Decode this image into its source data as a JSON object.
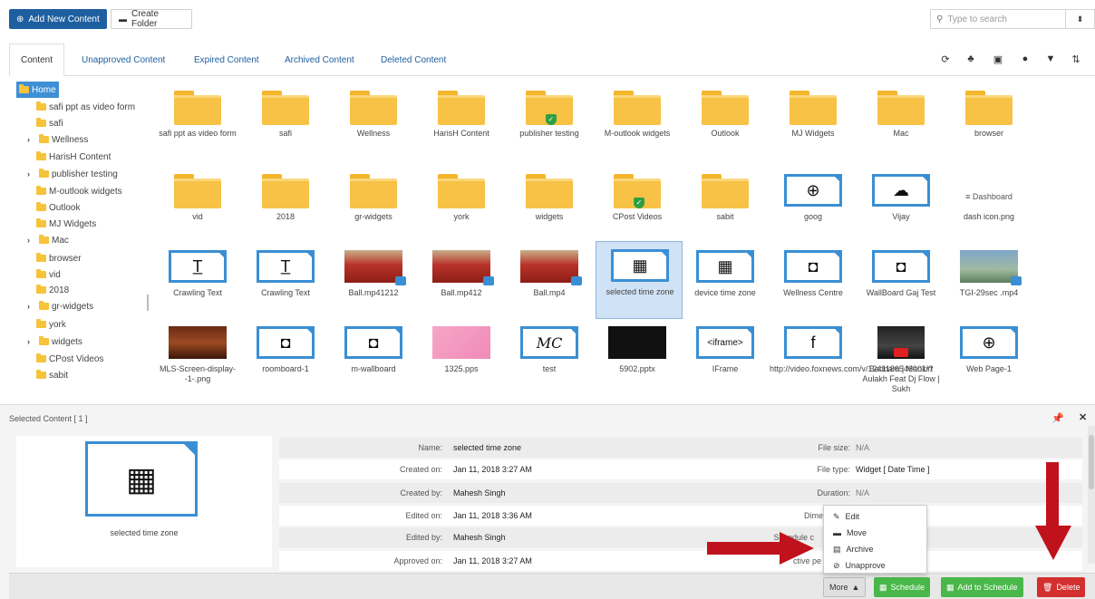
{
  "toolbar": {
    "add_label": "Add New Content",
    "folder_label": "Create Folder",
    "search_placeholder": "Type to search"
  },
  "tabs": [
    {
      "label": "Content"
    },
    {
      "label": "Unapproved Content"
    },
    {
      "label": "Expired Content"
    },
    {
      "label": "Archived Content"
    },
    {
      "label": "Deleted Content"
    }
  ],
  "tree": {
    "home": "Home",
    "items": [
      {
        "label": "safi ppt as video form"
      },
      {
        "label": "safi"
      },
      {
        "label": "Wellness"
      },
      {
        "label": "HarisH Content"
      },
      {
        "label": "publisher testing"
      },
      {
        "label": "M-outlook widgets"
      },
      {
        "label": "Outlook"
      },
      {
        "label": "MJ Widgets"
      },
      {
        "label": "Mac"
      },
      {
        "label": "browser"
      },
      {
        "label": "vid"
      },
      {
        "label": "2018"
      },
      {
        "label": "gr-widgets"
      },
      {
        "label": "york"
      },
      {
        "label": "widgets"
      },
      {
        "label": "CPost Videos"
      },
      {
        "label": "sabit"
      }
    ]
  },
  "grid": {
    "row1": [
      "safi ppt as video form",
      "safi",
      "Wellness",
      "HarisH Content",
      "publisher testing",
      "M-outlook widgets",
      "Outlook",
      "MJ Widgets",
      "Mac",
      "browser"
    ],
    "row2": [
      "vid",
      "2018",
      "gr-widgets",
      "york",
      "widgets",
      "CPost Videos",
      "sabit",
      "goog",
      "Vijay",
      "dash icon.png"
    ],
    "row3": [
      "Crawling Text",
      "Crawling Text",
      "Ball.mp41212",
      "Ball.mp412",
      "Ball.mp4",
      "selected time zone",
      "device time zone",
      "Wellness Centre",
      "WallBoard Gaj Test",
      "TGI-29sec .mp4"
    ],
    "row4": [
      "MLS-Screen-display--1-.png",
      "roomboard-1",
      "m-wallboard",
      "1325.pps",
      "test",
      "5902.pptx",
      "IFrame",
      "http://video.foxnews.com/v/1241186546001/?",
      "Badnam | Mankirt Aulakh Feat Dj Flow | Sukh",
      "Web Page-1"
    ],
    "dashboard_text": "≡ Dashboard",
    "iframe_text": "<iframe>",
    "mc_text": "MC"
  },
  "selected": {
    "header": "Selected Content [ 1 ]",
    "preview_label": "selected time zone",
    "fields": {
      "name_label": "Name:",
      "name": "selected time zone",
      "created_on_label": "Created on:",
      "created_on": "Jan 11, 2018 3:27 AM",
      "created_by_label": "Created by:",
      "created_by": "Mahesh Singh",
      "edited_on_label": "Edited on:",
      "edited_on": "Jan 11, 2018 3:36 AM",
      "edited_by_label": "Edited by:",
      "edited_by": "Mahesh Singh",
      "approved_on_label": "Approved on:",
      "approved_on": "Jan 11, 2018 3:27 AM",
      "file_size_label": "File size:",
      "file_size": "N/A",
      "file_type_label": "File type:",
      "file_type": "Widget [ Date Time ]",
      "duration_label": "Duration:",
      "duration": "N/A",
      "dimensions_label": "Dimen",
      "schedule_label": "Schedule c",
      "active_label": "ctive pe"
    }
  },
  "menu": {
    "edit": "Edit",
    "move": "Move",
    "archive": "Archive",
    "unapprove": "Unapprove"
  },
  "footer": {
    "more": "More",
    "schedule": "Schedule",
    "add_to_schedule": "Add to Schedule",
    "delete": "Delete"
  },
  "colors": {
    "primary": "#1e5fa0",
    "folder": "#f7c245",
    "widget_border": "#3a8fd4",
    "green": "#4ab74a",
    "red": "#d32f2f",
    "arrow": "#c0121c"
  }
}
